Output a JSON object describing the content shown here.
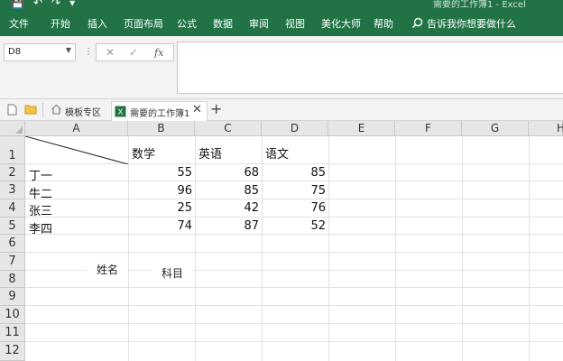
{
  "title_bar": {
    "document_title": "需要的工作簿1 - Excel"
  },
  "ribbon_tabs": [
    "文件",
    "开始",
    "插入",
    "页面布局",
    "公式",
    "数据",
    "审阅",
    "视图",
    "美化大师",
    "帮助"
  ],
  "tell_me": "告诉我你想要做什么",
  "formula_bar": {
    "name_box": "D8",
    "fx_label": "fx",
    "formula": ""
  },
  "workbook_tabs": {
    "tab1": "模板专区",
    "tab2": "需要的工作簿1"
  },
  "columns": [
    "A",
    "B",
    "C",
    "D",
    "E",
    "F",
    "G",
    "H"
  ],
  "rows": [
    "1",
    "2",
    "3",
    "4",
    "5",
    "6",
    "7",
    "8",
    "9",
    "10",
    "11",
    "12"
  ],
  "sheet": {
    "headers": [
      "数学",
      "英语",
      "语文"
    ],
    "names": [
      "丁一",
      "牛二",
      "张三",
      "李四"
    ],
    "scores": [
      [
        55,
        68,
        85
      ],
      [
        96,
        85,
        75
      ],
      [
        25,
        42,
        76
      ],
      [
        74,
        87,
        52
      ]
    ],
    "textbox_name": "姓名",
    "textbox_subject": "科目"
  },
  "colors": {
    "accent": "#217346"
  }
}
